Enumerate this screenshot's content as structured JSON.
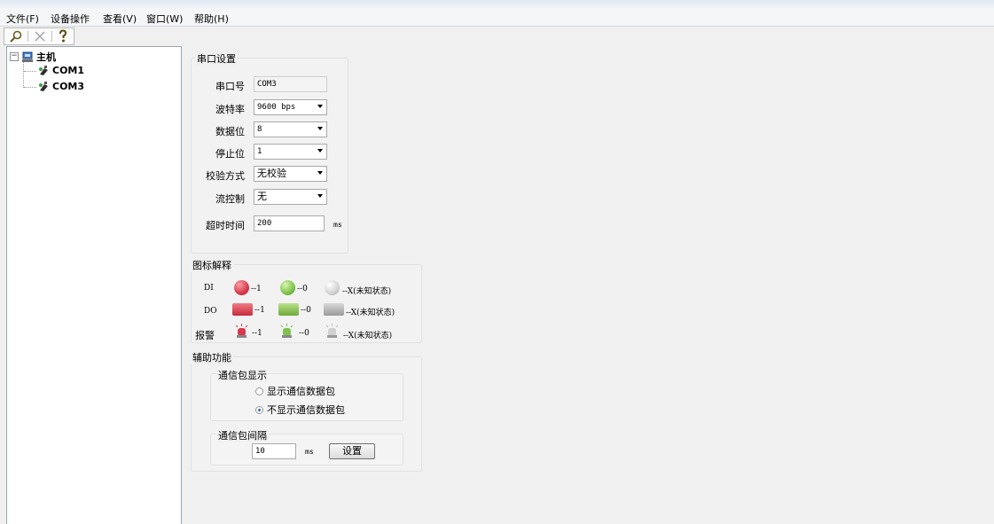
{
  "menu": [
    "文件(F)",
    "设备操作",
    "查看(V)",
    "窗口(W)",
    "帮助(H)"
  ],
  "toolbar": {
    "icons": [
      "search-icon",
      "close-icon",
      "help-icon"
    ]
  },
  "tree": {
    "root": "主机",
    "children": [
      "COM1",
      "COM3"
    ]
  },
  "serial": {
    "title": "串口设置",
    "port_label": "串口号",
    "port_value": "COM3",
    "baud_label": "波特率",
    "baud_value": "9600 bps",
    "databits_label": "数据位",
    "databits_value": "8",
    "stopbits_label": "停止位",
    "stopbits_value": "1",
    "parity_label": "校验方式",
    "parity_value": "无校验",
    "flow_label": "流控制",
    "flow_value": "无",
    "timeout_label": "超时时间",
    "timeout_value": "200",
    "timeout_unit": "ms"
  },
  "legend": {
    "title": "图标解释",
    "rows": [
      {
        "label": "DI",
        "on": "--1",
        "off": "--0",
        "unknown": "--X(未知状态)"
      },
      {
        "label": "DO",
        "on": "--1",
        "off": "--0",
        "unknown": "--X(未知状态)"
      },
      {
        "label": "报警",
        "on": "--1",
        "off": "--0",
        "unknown": "--X(未知状态)"
      }
    ],
    "colors": {
      "red": "#d83a4a",
      "green": "#7ec24b",
      "gray": "#c9c9c9"
    }
  },
  "aux": {
    "title": "辅助功能",
    "packet_display_title": "通信包显示",
    "show_label": "显示通信数据包",
    "hide_label": "不显示通信数据包",
    "selected": "hide",
    "interval_title": "通信包间隔",
    "interval_value": "10",
    "interval_unit": "ms",
    "set_button": "设置"
  }
}
